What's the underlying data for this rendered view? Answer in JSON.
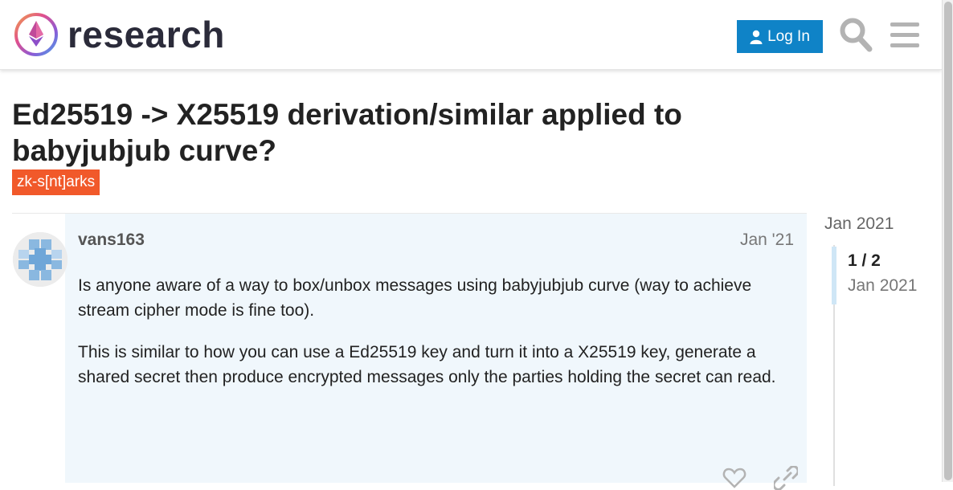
{
  "header": {
    "site_name": "research",
    "login_label": "Log In",
    "search_icon": "search-icon",
    "menu_icon": "hamburger-menu-icon",
    "brand_color": "#0f83c7"
  },
  "topic": {
    "title": "Ed25519 -> X25519 derivation/similar applied to babyjubjub curve?",
    "category": "zk-s[nt]arks",
    "category_color": "#f1592a"
  },
  "post": {
    "username": "vans163",
    "date": "Jan '21",
    "paragraphs": [
      "Is anyone aware of a way to box/unbox messages using babyjubjub curve (way to achieve stream cipher mode is fine too).",
      "This is similar to how you can use a Ed25519 key and turn it into a X25519 key, generate a shared secret then produce encrypted messages only the parties holding the secret can read."
    ],
    "actions": [
      "heart-icon",
      "link-icon"
    ]
  },
  "timeline": {
    "start_date": "Jan 2021",
    "position": "1 / 2",
    "current_date": "Jan 2021"
  }
}
